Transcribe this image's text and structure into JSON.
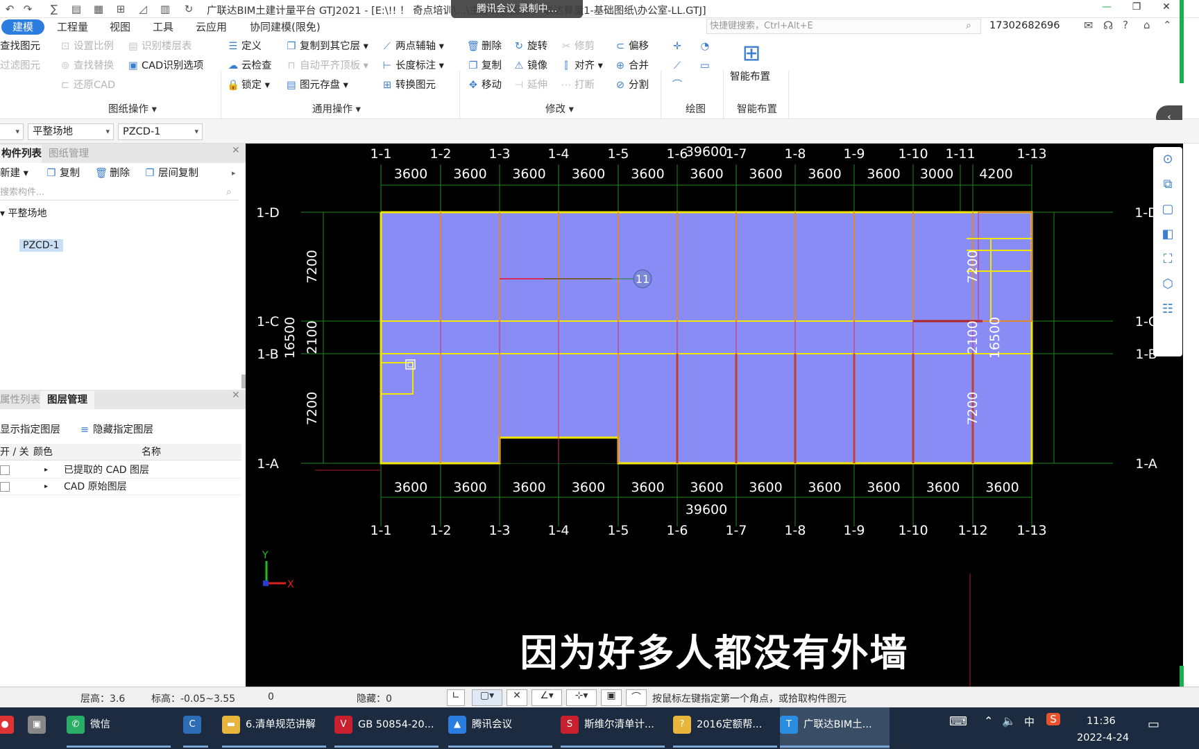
{
  "window": {
    "title": "广联达BIM土建计量平台 GTJ2021 - [E:\\!! ！ 奇点培训\\...\\主办公室图纸-广联达算量1-基础图纸\\办公室-LL.GTJ]",
    "meeting": "腾讯会议 录制中..."
  },
  "menu": [
    "建模",
    "工程量",
    "视图",
    "工具",
    "云应用",
    "协同建模(限免)"
  ],
  "search": {
    "placeholder": "快捷键搜索，Ctrl+Alt+E"
  },
  "user": "17302682696",
  "ribbon": {
    "drawing_ops": {
      "items": [
        "查找图元",
        "过滤图元",
        "设置比例",
        "查找替换",
        "还原CAD",
        "识别楼层表",
        "CAD识别选项"
      ],
      "group": "图纸操作"
    },
    "general_ops": {
      "items": [
        "定义",
        "云检查",
        "锁定",
        "复制到其它层",
        "自动平齐顶板",
        "图元存盘",
        "两点辅轴",
        "长度标注",
        "转换图元"
      ],
      "group": "通用操作"
    },
    "modify": {
      "items": [
        "删除",
        "复制",
        "移动",
        "旋转",
        "镜像",
        "延伸",
        "修剪",
        "对齐",
        "打断",
        "偏移",
        "合并",
        "分割"
      ],
      "group": "修改"
    },
    "draw": {
      "group": "绘图"
    },
    "smart": {
      "label": "智能布置",
      "group": "智能布置"
    }
  },
  "selectors": [
    "平整场地",
    "PZCD-1"
  ],
  "component_panel": {
    "tabs": [
      "构件列表",
      "图纸管理"
    ],
    "actions": [
      "新建",
      "复制",
      "删除",
      "层间复制"
    ],
    "search_placeholder": "搜索构件...",
    "tree_root": "平整场地",
    "tree_item": "PZCD-1"
  },
  "layer_panel": {
    "tabs": [
      "属性列表",
      "图层管理"
    ],
    "actions": [
      "显示指定图层",
      "隐藏指定图层"
    ],
    "headers": [
      "开 / 关",
      "颜色",
      "名称"
    ],
    "rows": [
      "已提取的 CAD 图层",
      "CAD 原始图层"
    ]
  },
  "cad": {
    "top_axes": [
      "1-1",
      "1-2",
      "1-3",
      "1-4",
      "1-5",
      "1-6",
      "1-7",
      "1-8",
      "1-9",
      "1-10",
      "1-11",
      "1-13"
    ],
    "bottom_axes": [
      "1-1",
      "1-2",
      "1-3",
      "1-4",
      "1-5",
      "1-6",
      "1-7",
      "1-8",
      "1-9",
      "1-10",
      "1-12",
      "1-13"
    ],
    "top_dims": [
      "3600",
      "3600",
      "3600",
      "3600",
      "3600",
      "3600",
      "3600",
      "3600",
      "3600",
      "3000",
      "4200"
    ],
    "bottom_dims": [
      "3600",
      "3600",
      "3600",
      "3600",
      "3600",
      "3600",
      "3600",
      "3600",
      "3600",
      "3600",
      "3600"
    ],
    "total": "39600",
    "rows": [
      "1-D",
      "1-C",
      "1-B",
      "1-A"
    ],
    "vdims": [
      "7200",
      "2100",
      "7200"
    ],
    "vtotal": "16500",
    "marker": "11",
    "subtitle": "因为好多人都没有外墙"
  },
  "status": {
    "floor_height": "层高：",
    "floor_height_val": "3.6",
    "elev": "标高：",
    "elev_val": "-0.05~3.55",
    "count": "0",
    "hidden": "隐藏：",
    "hidden_val": "0",
    "hint": "按鼠标左键指定第一个角点，或拾取构件图元"
  },
  "taskbar": {
    "apps": [
      "微信",
      "6.清单规范讲解",
      "GB 50854-20...",
      "腾讯会议",
      "斯维尔清单计...",
      "2016定额帮...",
      "广联达BIM土..."
    ],
    "time": "11:36",
    "date": "2022-4-24",
    "ime": "中"
  }
}
